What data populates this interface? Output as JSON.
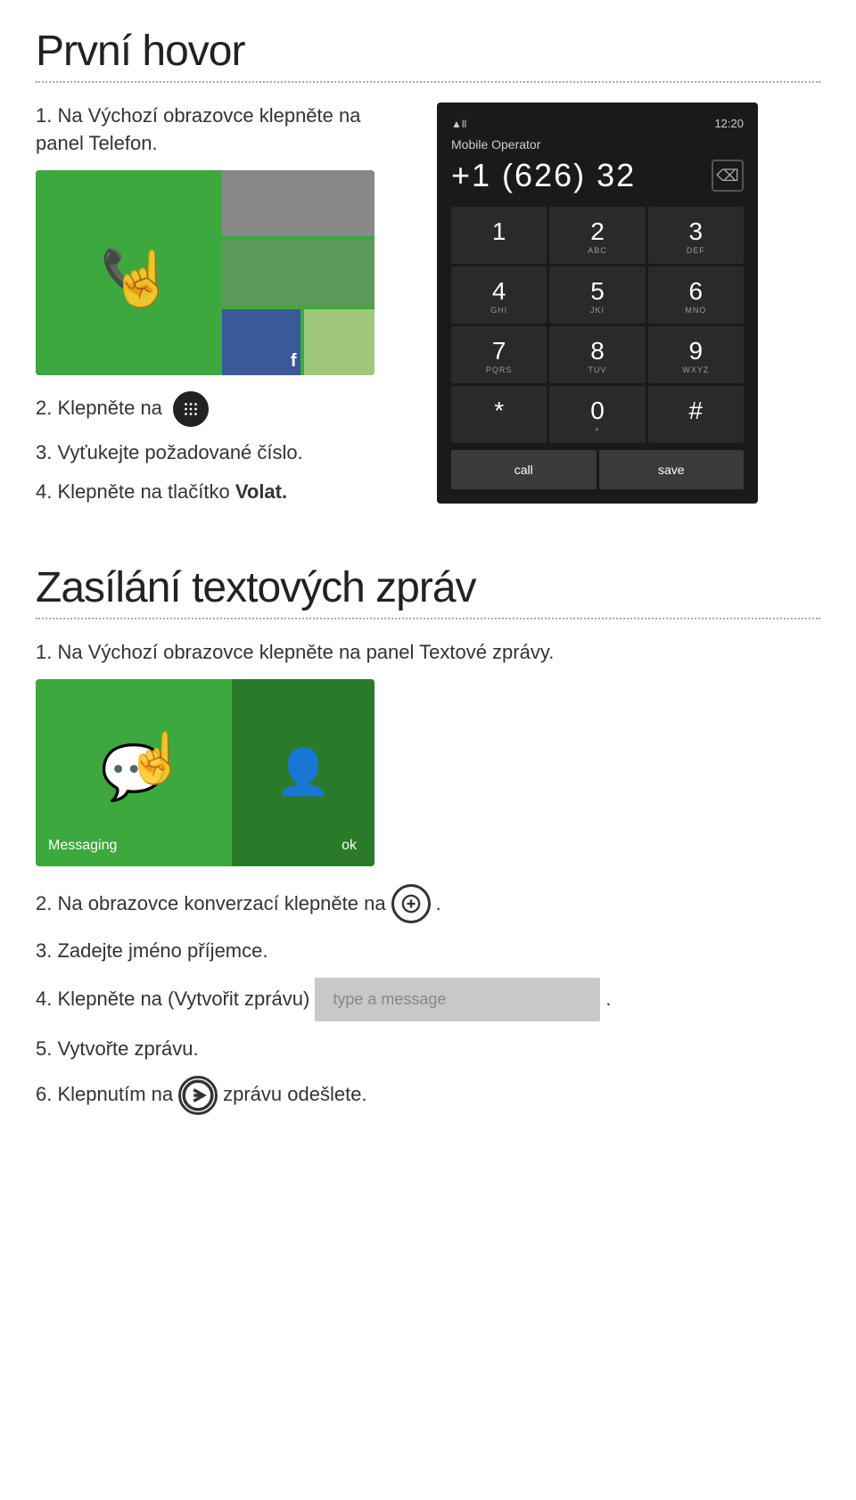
{
  "section1": {
    "title": "První hovor",
    "steps": [
      {
        "number": "1.",
        "text": "Na Výchozí obrazovce klepněte na panel Telefon."
      },
      {
        "number": "2.",
        "text": "Klepněte na"
      },
      {
        "number": "3.",
        "text": "Vyťukejte požadované číslo."
      },
      {
        "number": "4.",
        "text": "Klepněte na tlačítko ",
        "bold": "Volat."
      }
    ]
  },
  "dialpad": {
    "signal": "▲ll",
    "time": "12:20",
    "operator": "Mobile Operator",
    "number": "+1 (626) 32",
    "keys": [
      {
        "num": "1",
        "letters": ""
      },
      {
        "num": "2",
        "letters": "ABC"
      },
      {
        "num": "3",
        "letters": "DEF"
      },
      {
        "num": "4",
        "letters": "GHI"
      },
      {
        "num": "5",
        "letters": "JKI"
      },
      {
        "num": "6",
        "letters": "MNO"
      },
      {
        "num": "7",
        "letters": "PQRS"
      },
      {
        "num": "8",
        "letters": "TUV"
      },
      {
        "num": "9",
        "letters": "WXYZ"
      },
      {
        "num": "*",
        "letters": ""
      },
      {
        "num": "0",
        "letters": "+"
      },
      {
        "num": "#",
        "letters": ""
      }
    ],
    "call_label": "call",
    "save_label": "save"
  },
  "section2": {
    "title": "Zasílání textových zpráv",
    "steps": [
      {
        "number": "1.",
        "text": "Na Výchozí obrazovce klepněte na panel Textové zprávy."
      },
      {
        "number": "2.",
        "text": "Na obrazovce konverzací klepněte na"
      },
      {
        "number": "3.",
        "text": "Zadejte jméno příjemce."
      },
      {
        "number": "4.",
        "text": "Klepněte na (Vytvořit zprávu)"
      },
      {
        "number": "5.",
        "text": "Vytvořte zprávu."
      },
      {
        "number": "6.",
        "text": "Klepnutím na",
        "text2": "zprávu odešlete."
      }
    ],
    "messaging_label": "Messaging",
    "ok_label": "ok",
    "message_placeholder": "type a message"
  }
}
